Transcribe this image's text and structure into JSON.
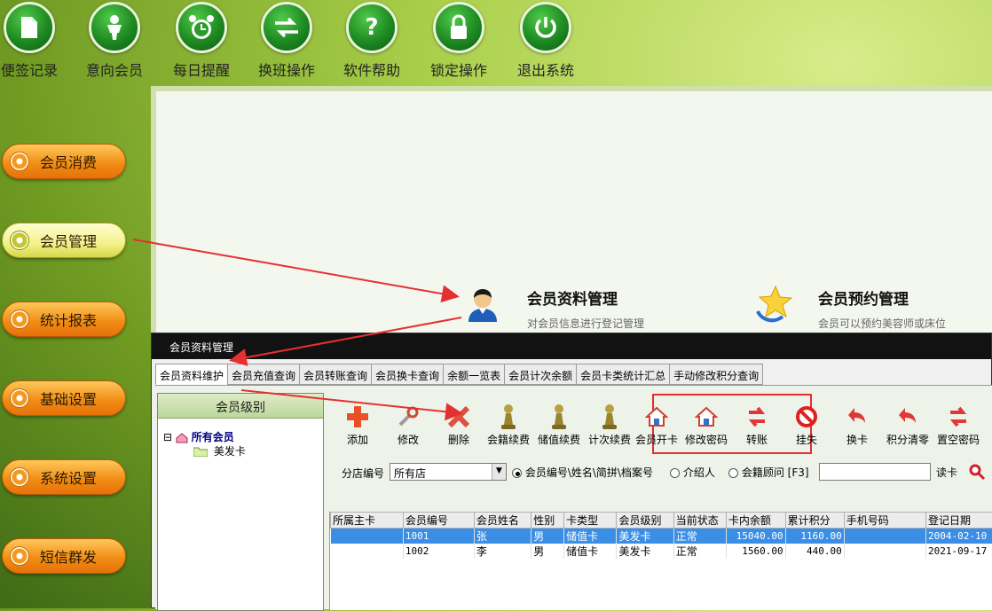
{
  "toolbar": {
    "items": [
      {
        "label": "便签记录",
        "icon": "note-icon"
      },
      {
        "label": "意向会员",
        "icon": "person-icon"
      },
      {
        "label": "每日提醒",
        "icon": "alarm-clock-icon"
      },
      {
        "label": "换班操作",
        "icon": "swap-arrows-icon"
      },
      {
        "label": "软件帮助",
        "icon": "help-icon"
      },
      {
        "label": "锁定操作",
        "icon": "lock-icon"
      },
      {
        "label": "退出系统",
        "icon": "power-icon"
      }
    ]
  },
  "sidebar": {
    "items": [
      {
        "label": "会员消费"
      },
      {
        "label": "会员管理",
        "active": true
      },
      {
        "label": "统计报表"
      },
      {
        "label": "基础设置"
      },
      {
        "label": "系统设置"
      },
      {
        "label": "短信群发"
      }
    ]
  },
  "cards": [
    {
      "title": "会员资料管理",
      "desc": "对会员信息进行登记管理"
    },
    {
      "title": "会员预约管理",
      "desc": "会员可以预约美容师或床位"
    }
  ],
  "window": {
    "title": "会员资料管理",
    "tabs": [
      "会员资料维护",
      "会员充值查询",
      "会员转账查询",
      "会员换卡查询",
      "余额一览表",
      "会员计次余额",
      "会员卡类统计汇总",
      "手动修改积分查询"
    ],
    "tree": {
      "header": "会员级别",
      "root": "所有会员",
      "expander": "⊟",
      "child": "美发卡"
    },
    "tools": [
      "添加",
      "修改",
      "删除",
      "会籍续费",
      "储值续费",
      "计次续费",
      "会员开卡",
      "修改密码",
      "转账",
      "挂失",
      "换卡",
      "积分清零",
      "置空密码"
    ],
    "filter": {
      "store_label": "分店编号",
      "store_value": "所有店",
      "radio1": "会员编号\\姓名\\简拼\\档案号",
      "radio2": "介绍人",
      "radio3": "会籍顾问 [F3]",
      "read_card": "读卡"
    },
    "table": {
      "columns": [
        "所属主卡",
        "会员编号",
        "会员姓名",
        "性别",
        "卡类型",
        "会员级别",
        "当前状态",
        "卡内余额",
        "累计积分",
        "手机号码",
        "登记日期"
      ],
      "rows": [
        [
          "",
          "1001",
          "张",
          "男",
          "储值卡",
          "美发卡",
          "正常",
          "15040.00",
          "1160.00",
          "",
          "2004-02-10"
        ],
        [
          "",
          "1002",
          "李",
          "男",
          "储值卡",
          "美发卡",
          "正常",
          "1560.00",
          "440.00",
          "",
          "2021-09-17"
        ]
      ]
    }
  },
  "colors": {
    "accent": "#e03030",
    "selected_row": "#3a8ee6"
  }
}
